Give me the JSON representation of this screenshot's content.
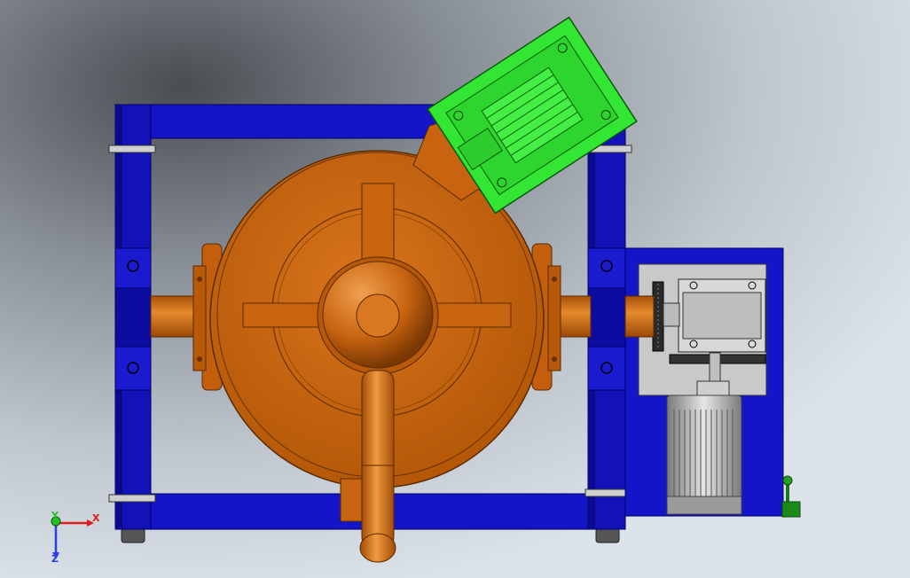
{
  "viewport": {
    "background_colors": [
      "#4a4d52",
      "#a9b0b8",
      "#dde3ea"
    ],
    "view": "top"
  },
  "triad": {
    "x_label": "X",
    "y_label": "Y",
    "z_label": "Z",
    "x_color": "#e01b1b",
    "y_color": "#22c022",
    "z_color": "#2a3fe0"
  },
  "colors": {
    "frame": "#1414c8",
    "frame_dark": "#0a0a8c",
    "drum": "#c8640f",
    "drum_dark": "#8a4006",
    "gearbox": "#33e633",
    "steel": "#c4c4c4",
    "motor": "#a8a8a8"
  },
  "parts": [
    "frame",
    "drum",
    "feeder-gearbox",
    "drive-unit",
    "motor",
    "lever"
  ]
}
